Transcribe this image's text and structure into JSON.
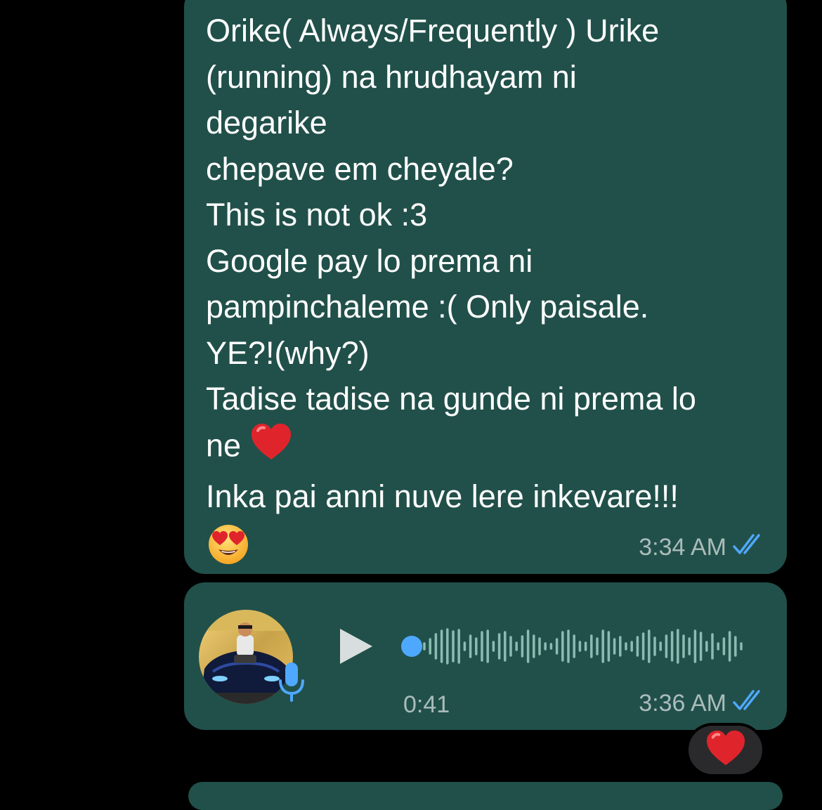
{
  "messages": [
    {
      "type": "text",
      "lines": [
        "Orike( Always/Frequently ) Urike",
        "(running) na hrudhayam ni",
        "degarike",
        "chepave em cheyale?",
        "This is not ok :3",
        "Google pay lo prema ni",
        "pampinchaleme :( Only paisale.",
        "YE?!(why?)",
        "Tadise tadise na gunde ni prema lo",
        "ne",
        "Inka pai anni nuve lere inkevare!!!"
      ],
      "inline_emoji_after_line_10": "red-heart",
      "trailing_emoji": "heart-eyes-face",
      "time": "3:34 AM",
      "status": "read"
    },
    {
      "type": "voice",
      "duration": "0:41",
      "time": "3:36 AM",
      "status": "read",
      "playback_progress": 0,
      "reaction": "red-heart"
    }
  ],
  "icons": {
    "play": "play-icon",
    "mic": "microphone-icon",
    "ticks": "double-check-icon"
  },
  "colors": {
    "background": "#000000",
    "bubble": "#21504a",
    "text": "#ffffff",
    "meta": "#a8b8b5",
    "read_ticks": "#4fa8ff",
    "mic": "#4fa8ff",
    "waveform": "#8bbcb2",
    "progress_dot": "#4fa8ff"
  }
}
